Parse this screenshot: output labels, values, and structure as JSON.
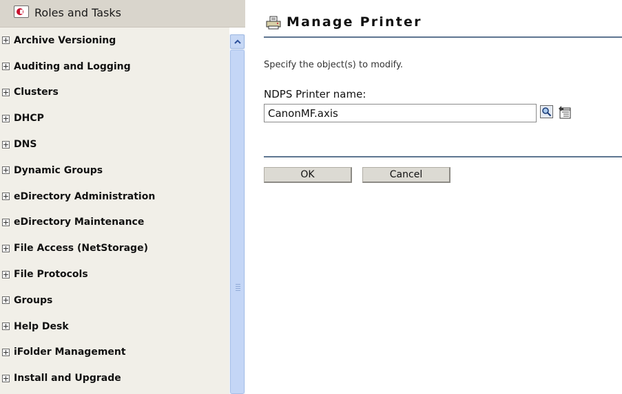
{
  "sidebar": {
    "title": "Roles and Tasks",
    "items": [
      {
        "label": "Archive Versioning"
      },
      {
        "label": "Auditing and Logging"
      },
      {
        "label": "Clusters"
      },
      {
        "label": "DHCP"
      },
      {
        "label": "DNS"
      },
      {
        "label": "Dynamic Groups"
      },
      {
        "label": "eDirectory Administration"
      },
      {
        "label": "eDirectory Maintenance"
      },
      {
        "label": "File Access (NetStorage)"
      },
      {
        "label": "File Protocols"
      },
      {
        "label": "Groups"
      },
      {
        "label": "Help Desk"
      },
      {
        "label": "iFolder Management"
      },
      {
        "label": "Install and Upgrade"
      }
    ]
  },
  "main": {
    "title": "Manage Printer",
    "instruction": "Specify the object(s) to modify.",
    "field_label": "NDPS Printer name:",
    "printer_name_value": "CanonMF.axis",
    "ok_label": "OK",
    "cancel_label": "Cancel"
  },
  "icons": {
    "sidebar_header": "roles-tasks-icon",
    "title": "printer-icon",
    "search": "search-icon",
    "browse": "object-browser-icon",
    "expand": "plus-box-icon"
  },
  "colors": {
    "sidebar_header_bg": "#d9d5cc",
    "sidebar_list_bg": "#f1efe8",
    "rule": "#5d7590",
    "button_bg": "#dcdad3",
    "scrollbar": "#c4d6f6"
  }
}
